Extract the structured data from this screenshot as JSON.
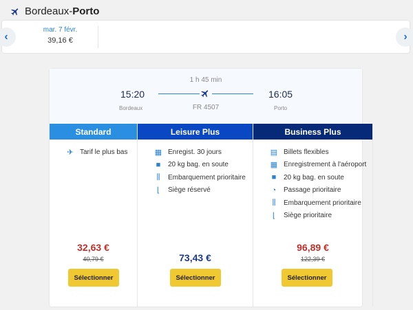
{
  "header": {
    "origin": "Bordeaux",
    "separator": " - ",
    "destination": "Porto"
  },
  "dates": {
    "prev_icon": "chevron-left-icon",
    "next_icon": "chevron-right-icon",
    "day": "mar. 7 févr.",
    "price": "39,16 €"
  },
  "flight": {
    "duration": "1 h 45 min",
    "dep_time": "15:20",
    "dep_city": "Bordeaux",
    "number": "FR 4507",
    "arr_time": "16:05",
    "arr_city": "Porto"
  },
  "fares": [
    {
      "name": "Standard",
      "color": "#2a8fe0",
      "features": [
        {
          "icon": "plane-icon",
          "label": "Tarif le plus bas"
        }
      ],
      "price": "32,63 €",
      "price_color": "#c0302a",
      "old_price": "40,79 €",
      "button": "Sélectionner"
    },
    {
      "name": "Leisure Plus",
      "color": "#0a47c2",
      "features": [
        {
          "icon": "checkin-icon",
          "label": "Enregist. 30 jours"
        },
        {
          "icon": "suitcase-icon",
          "label": "20 kg bag. en soute"
        },
        {
          "icon": "priority-boarding-icon",
          "label": "Embarquement prioritaire"
        },
        {
          "icon": "seat-icon",
          "label": "Siège réservé"
        }
      ],
      "price": "73,43 €",
      "price_color": "#1d3a8a",
      "button": "Sélectionner"
    },
    {
      "name": "Business Plus",
      "color": "#062a78",
      "features": [
        {
          "icon": "flexible-ticket-icon",
          "label": "Billets flexibles"
        },
        {
          "icon": "checkin-icon",
          "label": "Enregistrement à l'aéroport"
        },
        {
          "icon": "suitcase-icon",
          "label": "20 kg bag. en soute"
        },
        {
          "icon": "fast-track-icon",
          "label": "Passage prioritaire"
        },
        {
          "icon": "priority-boarding-icon",
          "label": "Embarquement prioritaire"
        },
        {
          "icon": "seat-icon",
          "label": "Siège prioritaire"
        }
      ],
      "price": "96,89 €",
      "price_color": "#c0302a",
      "old_price": "122,39 €",
      "button": "Sélectionner"
    }
  ]
}
